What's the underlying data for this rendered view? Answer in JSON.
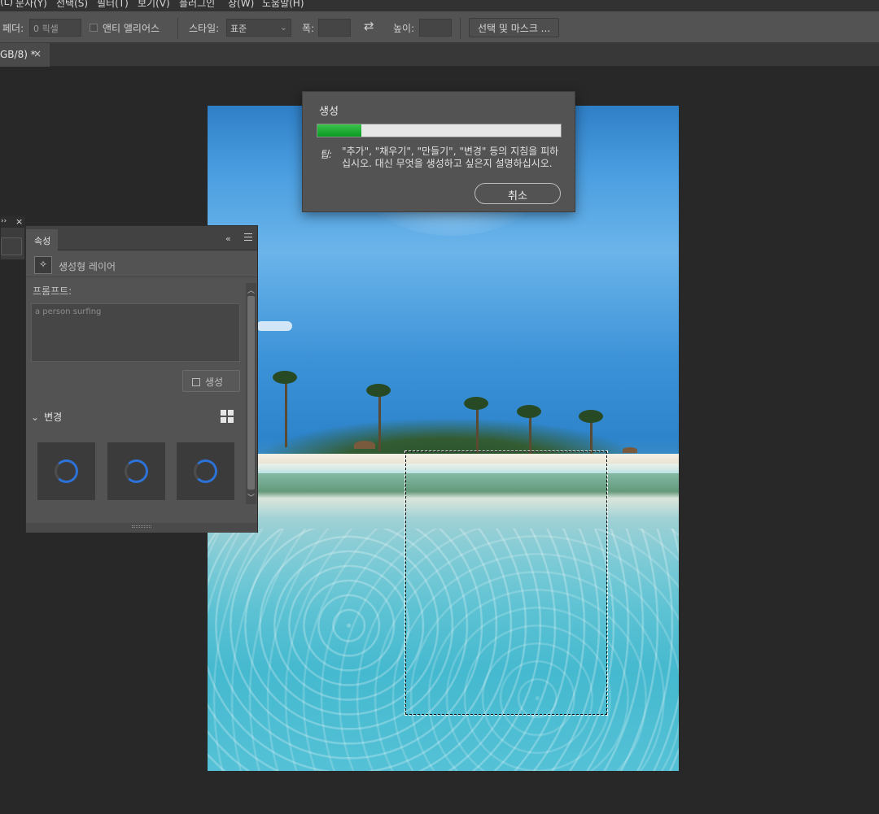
{
  "menubar": {
    "items": [
      "(L)",
      "문자(Y)",
      "선택(S)",
      "필터(T)",
      "보기(V)",
      "플러그인",
      "창(W)",
      "도움말(H)"
    ]
  },
  "options": {
    "feather_label": "페더:",
    "feather_value": "0 픽셀",
    "antialias_label": "앤티 앨리어스",
    "style_label": "스타일:",
    "style_value": "표준",
    "width_label": "폭:",
    "height_label": "높이:",
    "select_mask_label": "선택 및 마스크 ..."
  },
  "tab": {
    "label": "GB/8) *",
    "close": "×"
  },
  "dialog": {
    "title": "생성",
    "progress": 0.18,
    "tip_icon": "팁:",
    "tip_text": "\"추가\", \"채우기\", \"만들기\", \"변경\" 등의 지침을 피하십시오. 대신 무엇을 생성하고 싶은지 설명하십시오.",
    "cancel_label": "취소",
    "colors": {
      "progress": "#0a9a23",
      "panel": "#535353"
    }
  },
  "mini_panel": {
    "arrows": "››",
    "close": "×"
  },
  "properties": {
    "tab_label": "속성",
    "collapse": "«",
    "layer_icon": "generative-layer-icon",
    "layer_label": "생성형 레이어",
    "prompt_label": "프롬프트:",
    "prompt_value": "a person surfing",
    "generate_label": "생성",
    "variations_label": "변경",
    "variation_count": 3,
    "accent": "#2c72d8"
  }
}
